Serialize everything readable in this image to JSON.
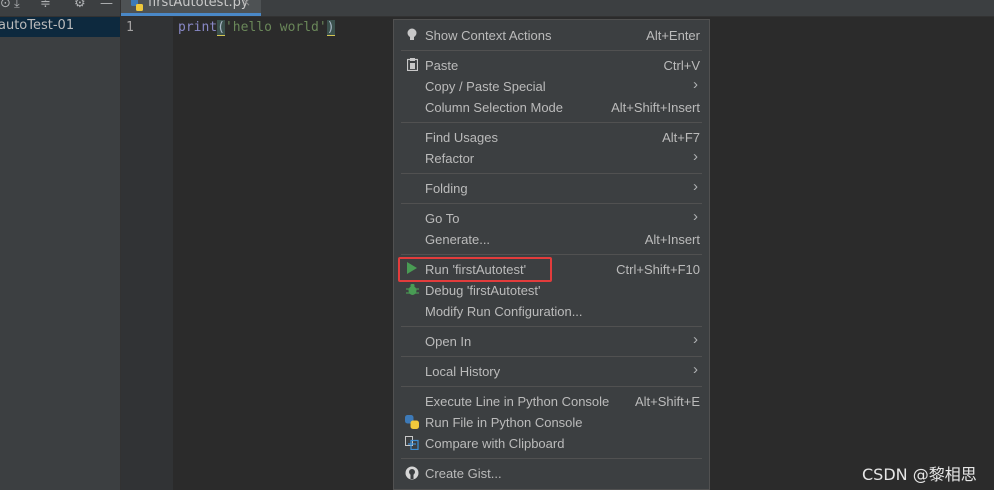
{
  "sidebar": {
    "project_item": "autoTest-01"
  },
  "toolbar": {
    "icons": [
      "locate-icon",
      "collapse-icon",
      "settings-icon",
      "minimize-icon"
    ]
  },
  "editor": {
    "tab": {
      "filename": "firstAutotest.py",
      "close": "×"
    },
    "line_number": "1",
    "code": {
      "keyword": "print",
      "open_paren": "(",
      "string": "'hello world'",
      "close_paren": ")"
    }
  },
  "context_menu": {
    "items": [
      {
        "label": "Show Context Actions",
        "shortcut": "Alt+Enter",
        "icon": "bulb-icon"
      },
      {
        "label": "Paste",
        "shortcut": "Ctrl+V",
        "icon": "clipboard-icon"
      },
      {
        "label": "Copy / Paste Special",
        "submenu": "›"
      },
      {
        "label": "Column Selection Mode",
        "shortcut": "Alt+Shift+Insert"
      },
      {
        "label": "Find Usages",
        "shortcut": "Alt+F7"
      },
      {
        "label": "Refactor",
        "submenu": "›"
      },
      {
        "label": "Folding",
        "submenu": "›"
      },
      {
        "label": "Go To",
        "submenu": "›"
      },
      {
        "label": "Generate...",
        "shortcut": "Alt+Insert"
      },
      {
        "label": "Run 'firstAutotest'",
        "shortcut": "Ctrl+Shift+F10",
        "icon": "run-icon"
      },
      {
        "label": "Debug 'firstAutotest'",
        "icon": "debug-icon"
      },
      {
        "label": "Modify Run Configuration..."
      },
      {
        "label": "Open In",
        "submenu": "›"
      },
      {
        "label": "Local History",
        "submenu": "›"
      },
      {
        "label": "Execute Line in Python Console",
        "shortcut": "Alt+Shift+E"
      },
      {
        "label": "Run File in Python Console",
        "icon": "python-icon"
      },
      {
        "label": "Compare with Clipboard",
        "icon": "compare-icon"
      },
      {
        "label": "Create Gist...",
        "icon": "github-icon"
      }
    ]
  },
  "watermark": "CSDN @黎相思",
  "colors": {
    "highlight_border": "#e23c3c",
    "run_green": "#499c54",
    "selection": "#0d293e"
  }
}
